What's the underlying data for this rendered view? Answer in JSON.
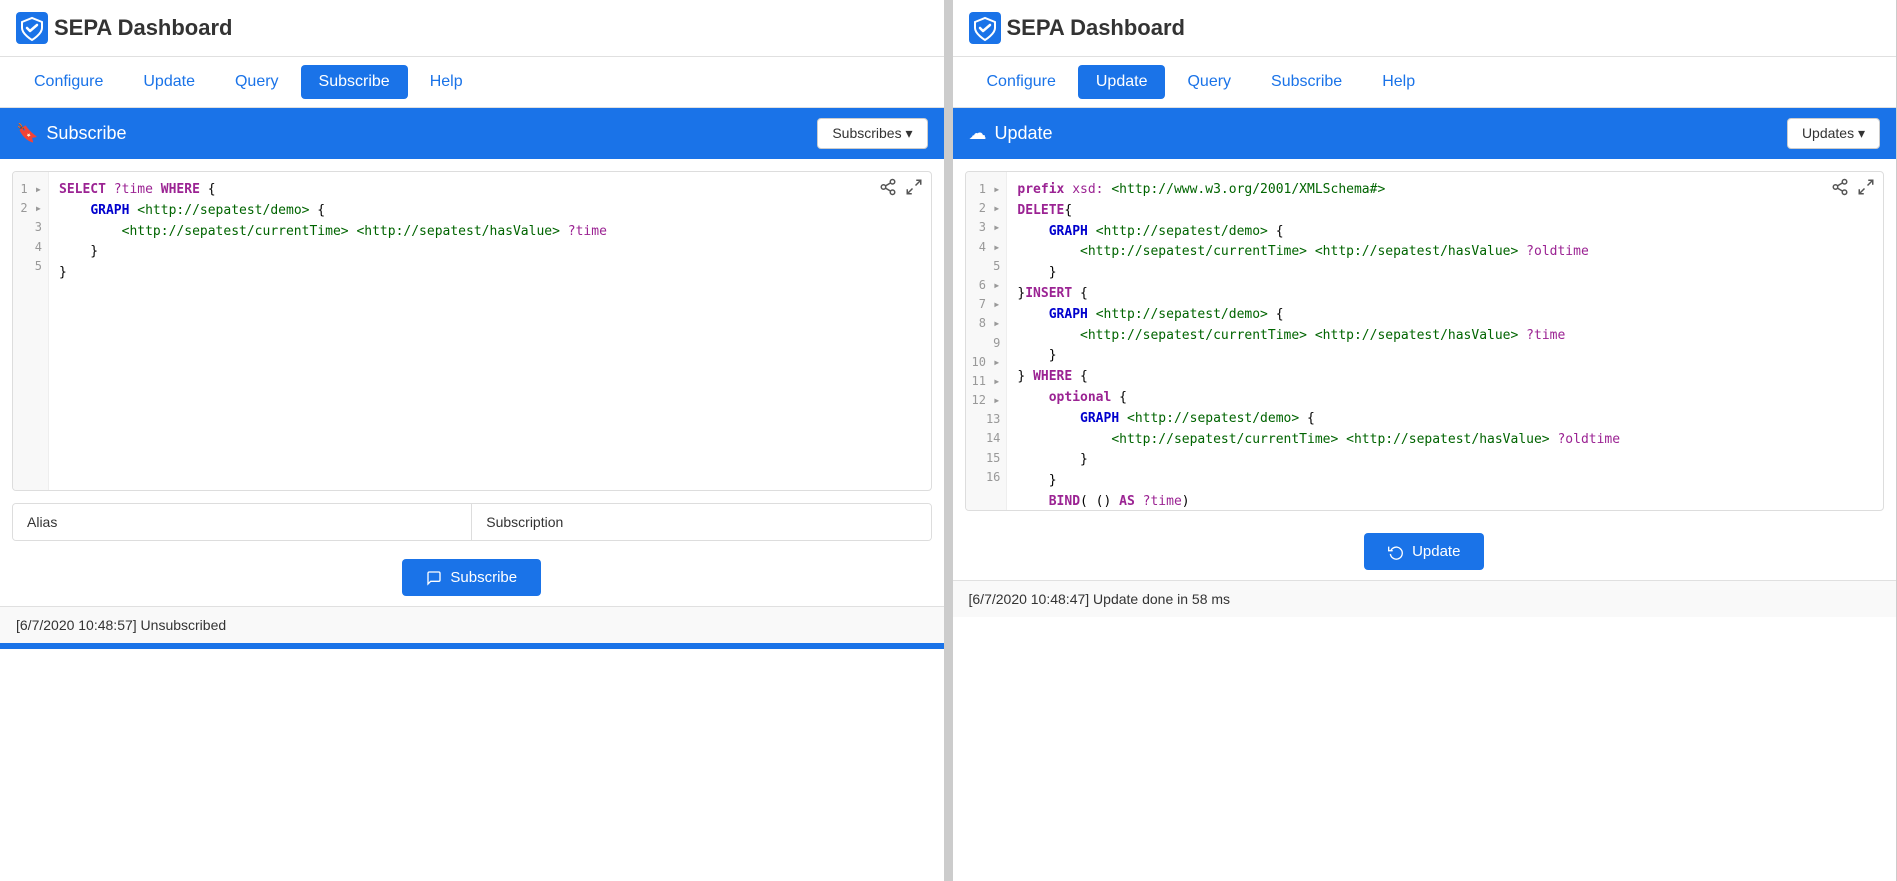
{
  "left": {
    "logo": {
      "title": "SEPA Dashboard",
      "icon_alt": "sepa-logo"
    },
    "nav": {
      "items": [
        {
          "label": "Configure",
          "active": false
        },
        {
          "label": "Update",
          "active": false
        },
        {
          "label": "Query",
          "active": false
        },
        {
          "label": "Subscribe",
          "active": true
        },
        {
          "label": "Help",
          "active": false
        }
      ]
    },
    "section": {
      "title": "Subscribe",
      "icon": "🔖",
      "dropdown_label": "Subscribes ▾"
    },
    "code": {
      "lines": [
        {
          "num": "1",
          "content": "SELECT ?time WHERE {"
        },
        {
          "num": "2",
          "content": "    GRAPH <http://sepatest/demo> {"
        },
        {
          "num": "3",
          "content": "        <http://sepatest/currentTime> <http://sepatest/hasValue> ?time"
        },
        {
          "num": "4",
          "content": "    }"
        },
        {
          "num": "5",
          "content": "}"
        }
      ]
    },
    "fields": [
      {
        "label": "Alias"
      },
      {
        "label": "Subscription"
      }
    ],
    "action_btn": "Subscribe",
    "status": "[6/7/2020 10:48:57] Unsubscribed"
  },
  "right": {
    "logo": {
      "title": "SEPA Dashboard",
      "icon_alt": "sepa-logo"
    },
    "nav": {
      "items": [
        {
          "label": "Configure",
          "active": false
        },
        {
          "label": "Update",
          "active": true
        },
        {
          "label": "Query",
          "active": false
        },
        {
          "label": "Subscribe",
          "active": false
        },
        {
          "label": "Help",
          "active": false
        }
      ]
    },
    "section": {
      "title": "Update",
      "icon": "☁",
      "dropdown_label": "Updates ▾"
    },
    "code": {
      "lines": [
        {
          "num": "1",
          "content": "prefix xsd: <http://www.w3.org/2001/XMLSchema#>"
        },
        {
          "num": "2",
          "content": "DELETE{"
        },
        {
          "num": "3",
          "content": "    GRAPH <http://sepatest/demo> {"
        },
        {
          "num": "4",
          "content": "        <http://sepatest/currentTime> <http://sepatest/hasValue> ?oldtime"
        },
        {
          "num": "5",
          "content": "    }"
        },
        {
          "num": "6",
          "content": "}INSERT {"
        },
        {
          "num": "7",
          "content": "    GRAPH <http://sepatest/demo> {"
        },
        {
          "num": "8",
          "content": "        <http://sepatest/currentTime> <http://sepatest/hasValue> ?time"
        },
        {
          "num": "9",
          "content": "    }"
        },
        {
          "num": "10",
          "content": "} WHERE {"
        },
        {
          "num": "11",
          "content": "    optional {"
        },
        {
          "num": "12",
          "content": "        GRAPH <http://sepatest/demo> {"
        },
        {
          "num": "13",
          "content": "            <http://sepatest/currentTime> <http://sepatest/hasValue> ?oldtime"
        },
        {
          "num": "14",
          "content": "        }"
        },
        {
          "num": "15",
          "content": "    }"
        },
        {
          "num": "16",
          "content": "    BIND( () AS ?time)"
        }
      ]
    },
    "action_btn": "Update",
    "status": "[6/7/2020 10:48:47] Update done in 58 ms"
  },
  "icons": {
    "share": "⇧",
    "fullscreen": "⛶",
    "refresh": "↺"
  }
}
